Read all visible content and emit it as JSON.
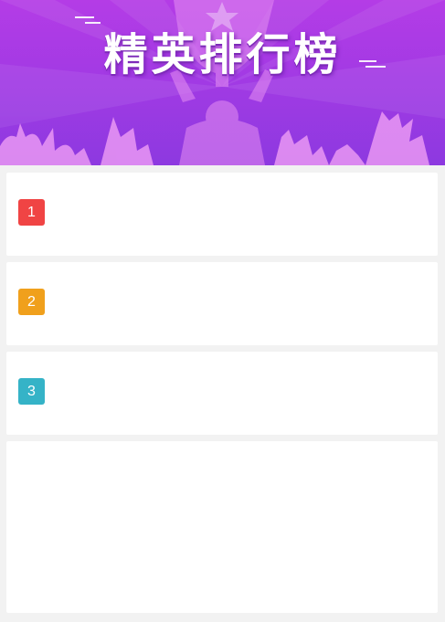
{
  "banner": {
    "title": "精英排行榜"
  },
  "ranking": [
    {
      "rank": "1",
      "badge_color": "#f04444"
    },
    {
      "rank": "2",
      "badge_color": "#f0a01c"
    },
    {
      "rank": "3",
      "badge_color": "#35b3c7"
    }
  ],
  "colors": {
    "banner_top": "#b43ce6",
    "banner_bottom": "#8d39e0",
    "page_background": "#f2f2f2",
    "card_background": "#ffffff"
  }
}
